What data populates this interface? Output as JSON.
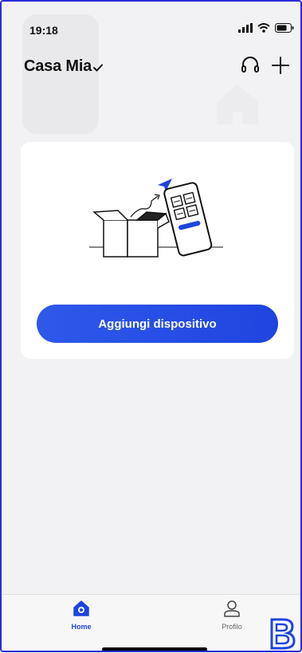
{
  "status_bar": {
    "time": "19:18"
  },
  "header": {
    "home_name": "Casa Mia"
  },
  "card": {
    "add_device_label": "Aggiungi dispositivo"
  },
  "tab_bar": {
    "tabs": [
      {
        "label": "Home",
        "icon": "home-icon",
        "active": true
      },
      {
        "label": "Profilo",
        "icon": "person-icon",
        "active": false
      }
    ]
  },
  "colors": {
    "accent": "#1f44e0",
    "background": "#f2f2f4",
    "card": "#ffffff"
  }
}
